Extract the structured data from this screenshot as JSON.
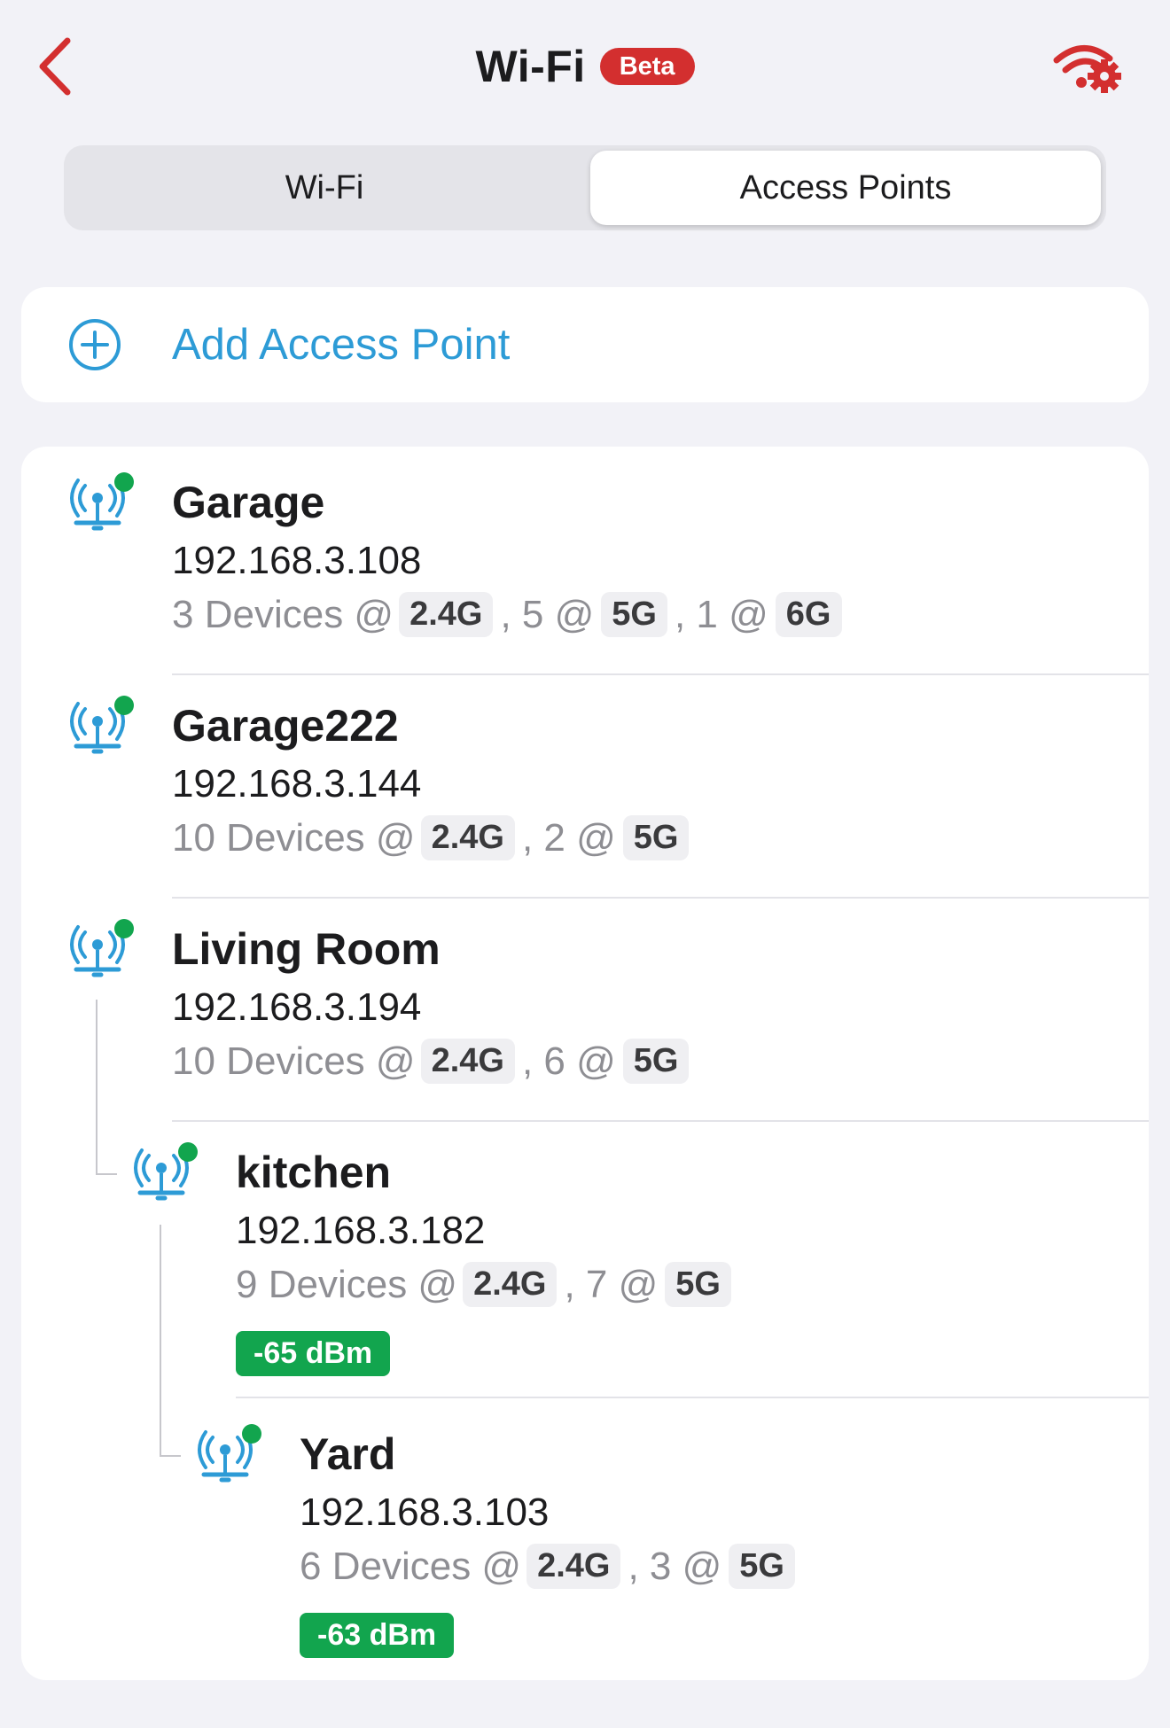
{
  "header": {
    "title": "Wi-Fi",
    "badge": "Beta",
    "accent_color": "#d32f2f",
    "back_icon": "chevron-left-icon",
    "settings_icon": "wifi-settings-icon"
  },
  "tabs": [
    {
      "label": "Wi-Fi",
      "selected": false
    },
    {
      "label": "Access Points",
      "selected": true
    }
  ],
  "add_access_point": {
    "label": "Add Access Point",
    "icon": "plus-circle-icon",
    "color": "#2d9bd6"
  },
  "access_points": [
    {
      "name": "Garage",
      "ip": "192.168.3.108",
      "status_color": "#12a54e",
      "devices": {
        "first_count": "3 Devices @",
        "bands": [
          {
            "band": "2.4G"
          },
          {
            "sep": ", 5 @",
            "band": "5G"
          },
          {
            "sep": ", 1 @",
            "band": "6G"
          }
        ]
      },
      "signal": null
    },
    {
      "name": "Garage222",
      "ip": "192.168.3.144",
      "status_color": "#12a54e",
      "devices": {
        "first_count": "10 Devices @",
        "bands": [
          {
            "band": "2.4G"
          },
          {
            "sep": ", 2 @",
            "band": "5G"
          }
        ]
      },
      "signal": null
    },
    {
      "name": "Living Room",
      "ip": "192.168.3.194",
      "status_color": "#12a54e",
      "devices": {
        "first_count": "10 Devices @",
        "bands": [
          {
            "band": "2.4G"
          },
          {
            "sep": ", 6 @",
            "band": "5G"
          }
        ]
      },
      "signal": null
    },
    {
      "name": "kitchen",
      "ip": "192.168.3.182",
      "status_color": "#12a54e",
      "devices": {
        "first_count": "9 Devices @",
        "bands": [
          {
            "band": "2.4G"
          },
          {
            "sep": ", 7 @",
            "band": "5G"
          }
        ]
      },
      "signal": "-65 dBm"
    },
    {
      "name": "Yard",
      "ip": "192.168.3.103",
      "status_color": "#12a54e",
      "devices": {
        "first_count": "6 Devices @",
        "bands": [
          {
            "band": "2.4G"
          },
          {
            "sep": ", 3 @",
            "band": "5G"
          }
        ]
      },
      "signal": "-63 dBm"
    }
  ]
}
